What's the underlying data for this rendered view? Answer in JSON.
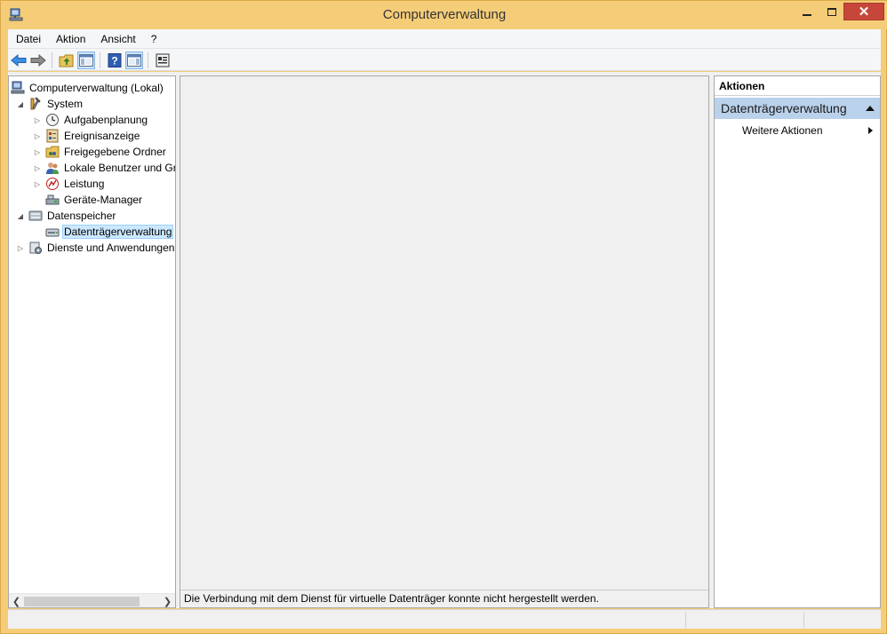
{
  "window": {
    "title": "Computerverwaltung",
    "close_glyph": "✕"
  },
  "menu": {
    "items": [
      "Datei",
      "Aktion",
      "Ansicht",
      "?"
    ]
  },
  "toolbar": {
    "buttons": [
      "back-icon",
      "forward-icon",
      "up-folder-icon",
      "show-hide-tree-icon",
      "help-icon",
      "show-hide-action-pane-icon",
      "properties-icon"
    ]
  },
  "tree": {
    "items": [
      {
        "label": "Computerverwaltung (Lokal)",
        "icon": "computer-management-icon",
        "expander": "",
        "level": 0
      },
      {
        "label": "System",
        "icon": "system-tools-icon",
        "expander": "◢",
        "level": 1
      },
      {
        "label": "Aufgabenplanung",
        "icon": "clock-icon",
        "expander": "▷",
        "level": 2
      },
      {
        "label": "Ereignisanzeige",
        "icon": "event-viewer-icon",
        "expander": "▷",
        "level": 2
      },
      {
        "label": "Freigegebene Ordner",
        "icon": "shared-folder-icon",
        "expander": "▷",
        "level": 2
      },
      {
        "label": "Lokale Benutzer und Gruppen",
        "icon": "users-icon",
        "expander": "▷",
        "level": 2
      },
      {
        "label": "Leistung",
        "icon": "performance-icon",
        "expander": "▷",
        "level": 2
      },
      {
        "label": "Geräte-Manager",
        "icon": "device-manager-icon",
        "expander": "",
        "level": 2
      },
      {
        "label": "Datenspeicher",
        "icon": "storage-icon",
        "expander": "◢",
        "level": 1
      },
      {
        "label": "Datenträgerverwaltung",
        "icon": "disk-management-icon",
        "expander": "",
        "level": 2,
        "selected": true
      },
      {
        "label": "Dienste und Anwendungen",
        "icon": "services-icon",
        "expander": "▷",
        "level": 1
      }
    ]
  },
  "center": {
    "status_message": "Die Verbindung mit dem Dienst für virtuelle Datenträger konnte nicht hergestellt werden."
  },
  "actions": {
    "header": "Aktionen",
    "section_title": "Datenträgerverwaltung",
    "items": [
      "Weitere Aktionen"
    ]
  },
  "colors": {
    "titlebar": "#f5cd78",
    "close_button": "#c7463a",
    "selection": "#cce8ff",
    "action_section": "#b9d1ea"
  }
}
